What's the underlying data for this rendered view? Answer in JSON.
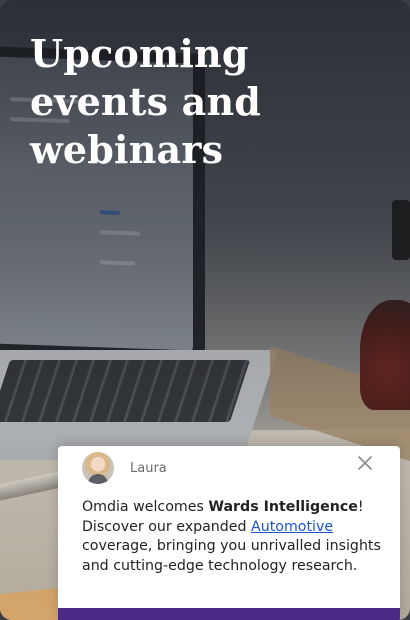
{
  "hero": {
    "title": "Upcoming events and webinars"
  },
  "chat": {
    "agent_name": "Laura",
    "close_icon": "close-icon",
    "message": {
      "part1": "Omdia welcomes ",
      "brand": "Wards Intelligence",
      "part2": "! Discover our expanded ",
      "link_text": "Automotive",
      "part3": " coverage, bringing you unrivalled insights and cutting-edge technology research."
    }
  },
  "colors": {
    "accent_purple": "#4b2a86",
    "link_blue": "#1a56c9",
    "title_white": "#ffffff"
  }
}
